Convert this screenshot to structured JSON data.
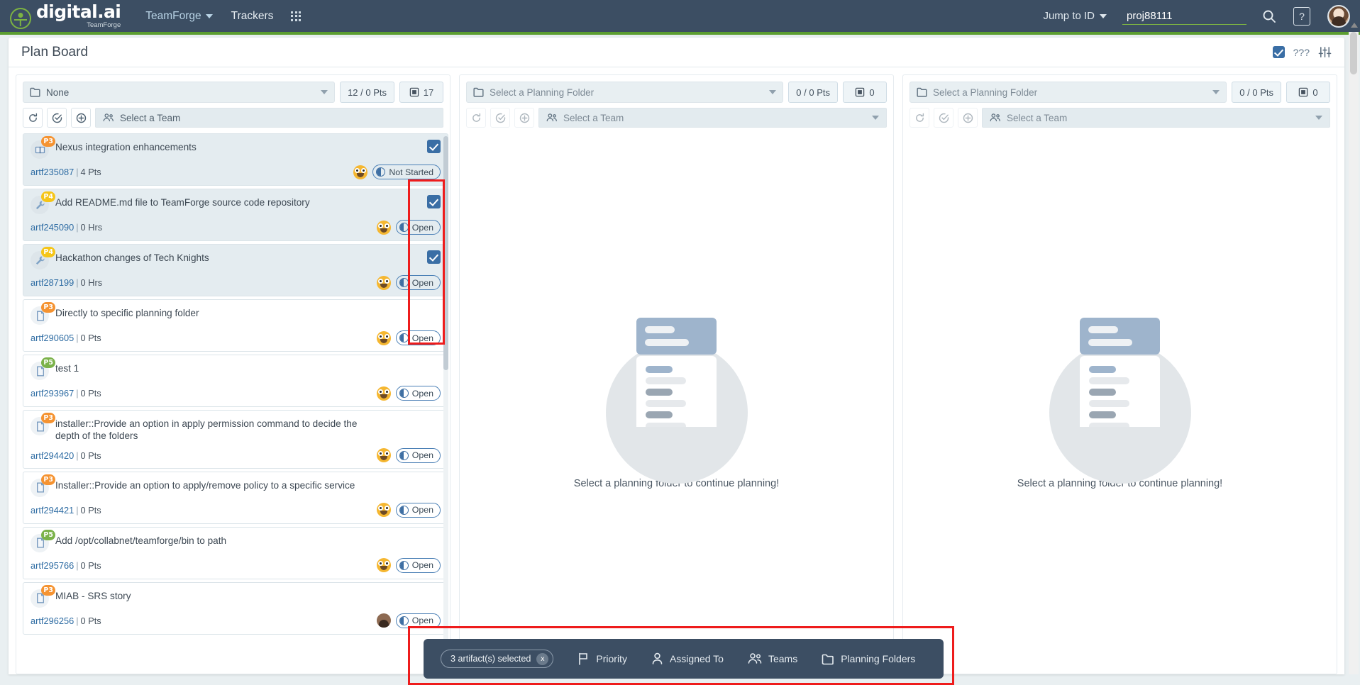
{
  "topnav": {
    "brand_word": "digital.ai",
    "brand_sub": "TeamForge",
    "product_menu": "TeamForge",
    "trackers": "Trackers",
    "jump_to_id": "Jump to ID",
    "project_value": "proj88111",
    "project_placeholder": "proj88111",
    "help_glyph": "?",
    "search_icon": "search-icon",
    "grid_icon": "app-grid-icon"
  },
  "page": {
    "title": "Plan Board",
    "header_checkbox_label": "???",
    "settings_icon": "sliders-icon"
  },
  "columns": [
    {
      "id": "col-1",
      "folder": "None",
      "points": "12 / 0 Pts",
      "count": "17",
      "team": "Select a Team",
      "dim": false,
      "cards": [
        {
          "title": "Nexus integration enhancements",
          "artifact": "artf235087",
          "effort": "4 Pts",
          "priority": "P3",
          "priority_color": "#f59331",
          "type_icon": "story-book-icon",
          "status": "Not Started",
          "assignee": "jake-avatar",
          "selected": true,
          "highlighted": true
        },
        {
          "title": "Add README.md file to TeamForge source code repository",
          "artifact": "artf245090",
          "effort": "0 Hrs",
          "priority": "P4",
          "priority_color": "#f5c518",
          "type_icon": "task-wrench-icon",
          "status": "Open",
          "assignee": "jake-avatar",
          "selected": true,
          "highlighted": true
        },
        {
          "title": "Hackathon changes of Tech Knights",
          "artifact": "artf287199",
          "effort": "0 Hrs",
          "priority": "P4",
          "priority_color": "#f5c518",
          "type_icon": "task-wrench-icon",
          "status": "Open",
          "assignee": "jake-avatar",
          "selected": true,
          "highlighted": true
        },
        {
          "title": "Directly to specific planning folder",
          "artifact": "artf290605",
          "effort": "0 Pts",
          "priority": "P3",
          "priority_color": "#f59331",
          "type_icon": "story-doc-icon",
          "status": "Open",
          "assignee": "jake-avatar",
          "selected": false,
          "highlighted": false
        },
        {
          "title": "test 1",
          "artifact": "artf293967",
          "effort": "0 Pts",
          "priority": "P5",
          "priority_color": "#7bb24a",
          "type_icon": "story-doc-icon",
          "status": "Open",
          "assignee": "jake-avatar",
          "selected": false,
          "highlighted": false
        },
        {
          "title": "installer::Provide an option in apply permission command to decide the depth of the folders",
          "artifact": "artf294420",
          "effort": "0 Pts",
          "priority": "P3",
          "priority_color": "#f59331",
          "type_icon": "story-doc-icon",
          "status": "Open",
          "assignee": "jake-avatar",
          "selected": false,
          "highlighted": false
        },
        {
          "title": "Installer::Provide an option to apply/remove policy to a specific service",
          "artifact": "artf294421",
          "effort": "0 Pts",
          "priority": "P3",
          "priority_color": "#f59331",
          "type_icon": "story-doc-icon",
          "status": "Open",
          "assignee": "jake-avatar",
          "selected": false,
          "highlighted": false
        },
        {
          "title": "Add /opt/collabnet/teamforge/bin to path",
          "artifact": "artf295766",
          "effort": "0 Pts",
          "priority": "P5",
          "priority_color": "#7bb24a",
          "type_icon": "story-doc-icon",
          "status": "Open",
          "assignee": "jake-avatar",
          "selected": false,
          "highlighted": false
        },
        {
          "title": "MIAB - SRS story",
          "artifact": "artf296256",
          "effort": "0 Pts",
          "priority": "P3",
          "priority_color": "#f59331",
          "type_icon": "story-doc-icon",
          "status": "Open",
          "assignee": "person-avatar",
          "selected": false,
          "highlighted": false
        }
      ]
    },
    {
      "id": "col-2",
      "folder": "Select a Planning Folder",
      "points": "0 / 0 Pts",
      "count": "0",
      "team": "Select a Team",
      "dim": true,
      "empty_text": "Select a planning folder to continue planning!",
      "cards": []
    },
    {
      "id": "col-3",
      "folder": "Select a Planning Folder",
      "points": "0 / 0 Pts",
      "count": "0",
      "team": "Select a Team",
      "dim": true,
      "empty_text": "Select a planning folder to continue planning!",
      "cards": []
    }
  ],
  "action_bar": {
    "selection_label": "3 artifact(s) selected",
    "clear_glyph": "x",
    "items": [
      {
        "label": "Priority",
        "icon": "flag-icon"
      },
      {
        "label": "Assigned To",
        "icon": "person-icon"
      },
      {
        "label": "Teams",
        "icon": "people-icon"
      },
      {
        "label": "Planning Folders",
        "icon": "folder-icon"
      }
    ]
  },
  "colors": {
    "nav_bg": "#3c4e63",
    "accent_green": "#5c9e31",
    "checkbox_blue": "#3a6ea5",
    "highlight_red": "#ee1c1c",
    "card_bg": "#e4ecf0",
    "link_blue": "#2e6ca3"
  }
}
